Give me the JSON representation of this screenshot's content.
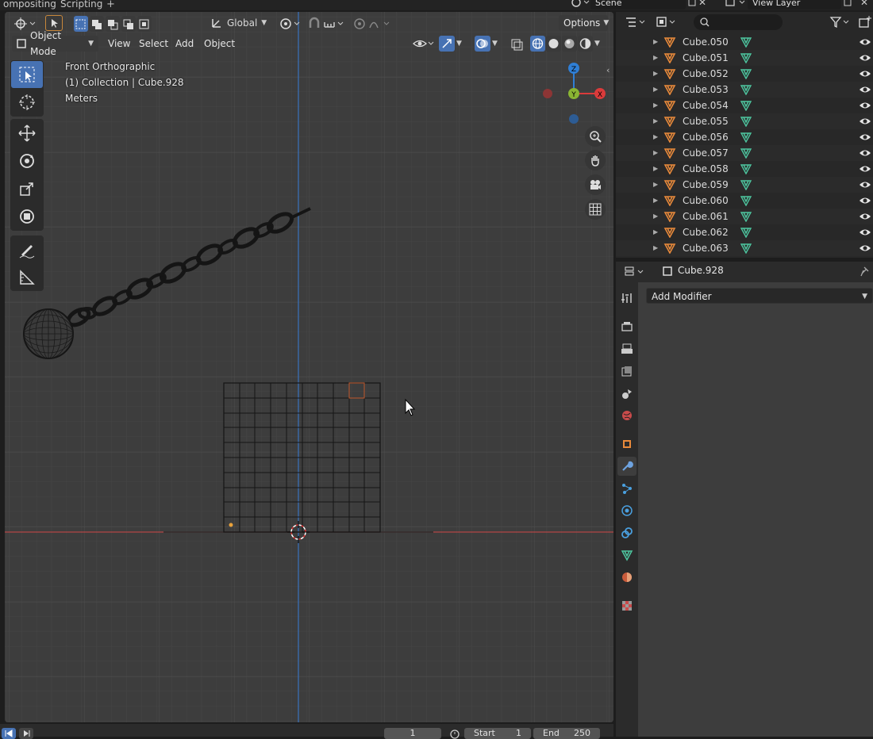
{
  "workspace_tabs": [
    "ompositing",
    "Scripting"
  ],
  "top_right": {
    "scene_label": "Scene",
    "view_layer_label": "View Layer"
  },
  "viewport_header": {
    "orientation": "Global",
    "options": "Options",
    "mode": "Object Mode",
    "menus": [
      "View",
      "Select",
      "Add",
      "Object"
    ]
  },
  "overlay": {
    "view_name": "Front Orthographic",
    "collection_info": "(1) Collection | Cube.928",
    "units": "Meters"
  },
  "gizmo": {
    "z": "Z",
    "y": "Y",
    "x": "X"
  },
  "outliner": {
    "items": [
      "Cube.050",
      "Cube.051",
      "Cube.052",
      "Cube.053",
      "Cube.054",
      "Cube.055",
      "Cube.056",
      "Cube.057",
      "Cube.058",
      "Cube.059",
      "Cube.060",
      "Cube.061",
      "Cube.062",
      "Cube.063"
    ]
  },
  "properties": {
    "object_name": "Cube.928",
    "add_modifier": "Add Modifier"
  },
  "timeline": {
    "current_frame": "1",
    "start_label": "Start",
    "start_value": "1",
    "end_label": "End",
    "end_value": "250"
  },
  "colors": {
    "accent": "#4772b3",
    "x_axis": "#db3b3b",
    "y_axis": "#8ab533",
    "z_axis": "#2f7fd6",
    "mesh_icon": "#e98a3b",
    "data_icon": "#4ec7a0"
  }
}
